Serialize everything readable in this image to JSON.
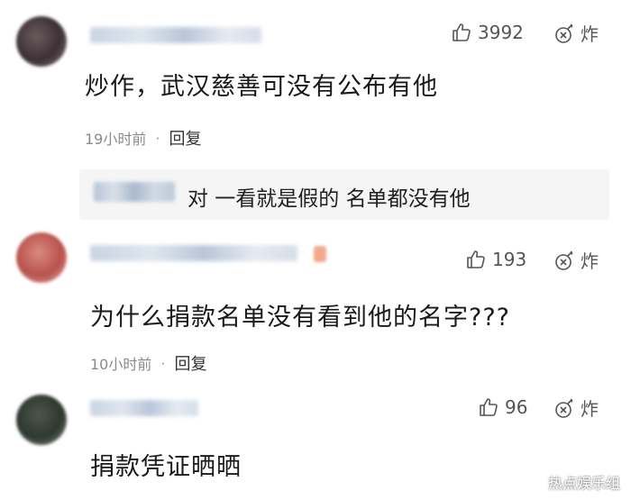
{
  "comments": [
    {
      "likes": "3992",
      "bomb_label": "炸",
      "text": "炒作，武汉慈善可没有公布有他",
      "time": "19小时前",
      "separator": "·",
      "reply_label": "回复",
      "reply_preview": "对 一看就是假的  名单都没有他"
    },
    {
      "likes": "193",
      "bomb_label": "炸",
      "text": "为什么捐款名单没有看到他的名字???",
      "time": "10小时前",
      "separator": "·",
      "reply_label": "回复"
    },
    {
      "likes": "96",
      "bomb_label": "炸",
      "text": "捐款凭证晒晒"
    }
  ],
  "watermark": "热点娱乐组",
  "icons": {
    "like": "thumbs-up-icon",
    "bomb": "bomb-icon"
  },
  "colors": {
    "text": "#1a1a1a",
    "meta": "#8a8a8a",
    "reply_bg": "#f5f5f5"
  }
}
